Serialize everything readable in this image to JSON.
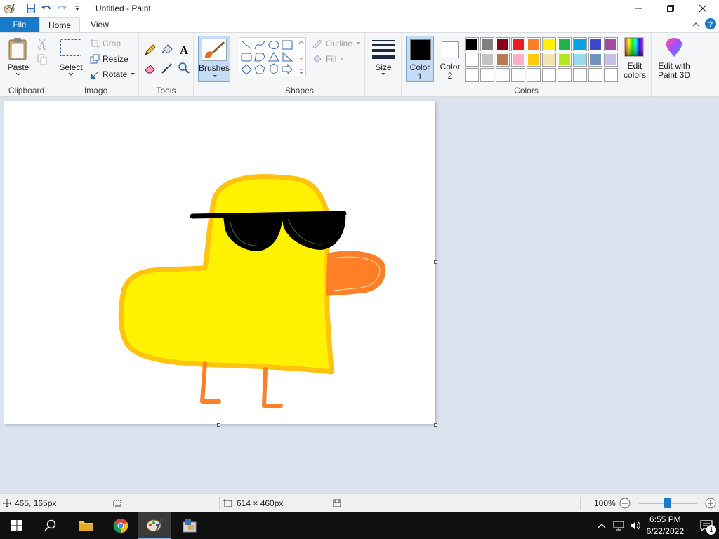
{
  "window": {
    "title": "Untitled - Paint",
    "app_icon": "paint-palette-icon",
    "minimize_icon": "minimize-icon",
    "maximize_icon": "restore-icon",
    "close_icon": "close-icon"
  },
  "quick_access": {
    "save_icon": "save-icon",
    "undo_icon": "undo-icon",
    "redo_icon": "redo-icon",
    "customize_icon": "dropdown-icon"
  },
  "tabs": [
    {
      "label": "File"
    },
    {
      "label": "Home"
    },
    {
      "label": "View"
    }
  ],
  "ribbon": {
    "clipboard": {
      "label": "Clipboard",
      "paste": "Paste"
    },
    "image": {
      "label": "Image",
      "select": "Select",
      "crop": "Crop",
      "resize": "Resize",
      "rotate": "Rotate"
    },
    "tools": {
      "label": "Tools"
    },
    "brushes": {
      "label": "Brushes"
    },
    "shapes": {
      "label": "Shapes",
      "outline": "Outline",
      "fill": "Fill"
    },
    "size": {
      "label": "Size"
    },
    "colors": {
      "label": "Colors",
      "color1_label": "Color",
      "color1_num": "1",
      "color2_label": "Color",
      "color2_num": "2",
      "color1_value": "#000000",
      "color2_value": "#ffffff",
      "edit_colors_line1": "Edit",
      "edit_colors_line2": "colors",
      "paint3d_line1": "Edit with",
      "paint3d_line2": "Paint 3D",
      "palette_row1": [
        "#000000",
        "#7f7f7f",
        "#880015",
        "#ed1c24",
        "#ff7f27",
        "#fff200",
        "#22b14c",
        "#00a2e8",
        "#3f48cc",
        "#a349a4"
      ],
      "palette_row2": [
        "#ffffff",
        "#c3c3c3",
        "#b97a57",
        "#ffaec9",
        "#ffc90e",
        "#efe4b0",
        "#b5e61d",
        "#99d9ea",
        "#7092be",
        "#c8bfe7"
      ],
      "palette_row3": [
        "#ffffff",
        "#ffffff",
        "#ffffff",
        "#ffffff",
        "#ffffff",
        "#ffffff",
        "#ffffff",
        "#ffffff",
        "#ffffff",
        "#ffffff"
      ]
    }
  },
  "drawing": {
    "description": "Yellow duck wearing black sunglasses with orange beak and legs",
    "body_color": "#fff200",
    "outline_color": "#ffc20e",
    "beak_color": "#ff7f27",
    "glasses_color": "#000000"
  },
  "status": {
    "cursor_pos": "465, 165px",
    "canvas_size": "614 × 460px",
    "zoom": "100%",
    "zoom_level": 0.5
  },
  "taskbar": {
    "time": "6:55 PM",
    "date": "6/22/2022",
    "notification_count": "1"
  }
}
